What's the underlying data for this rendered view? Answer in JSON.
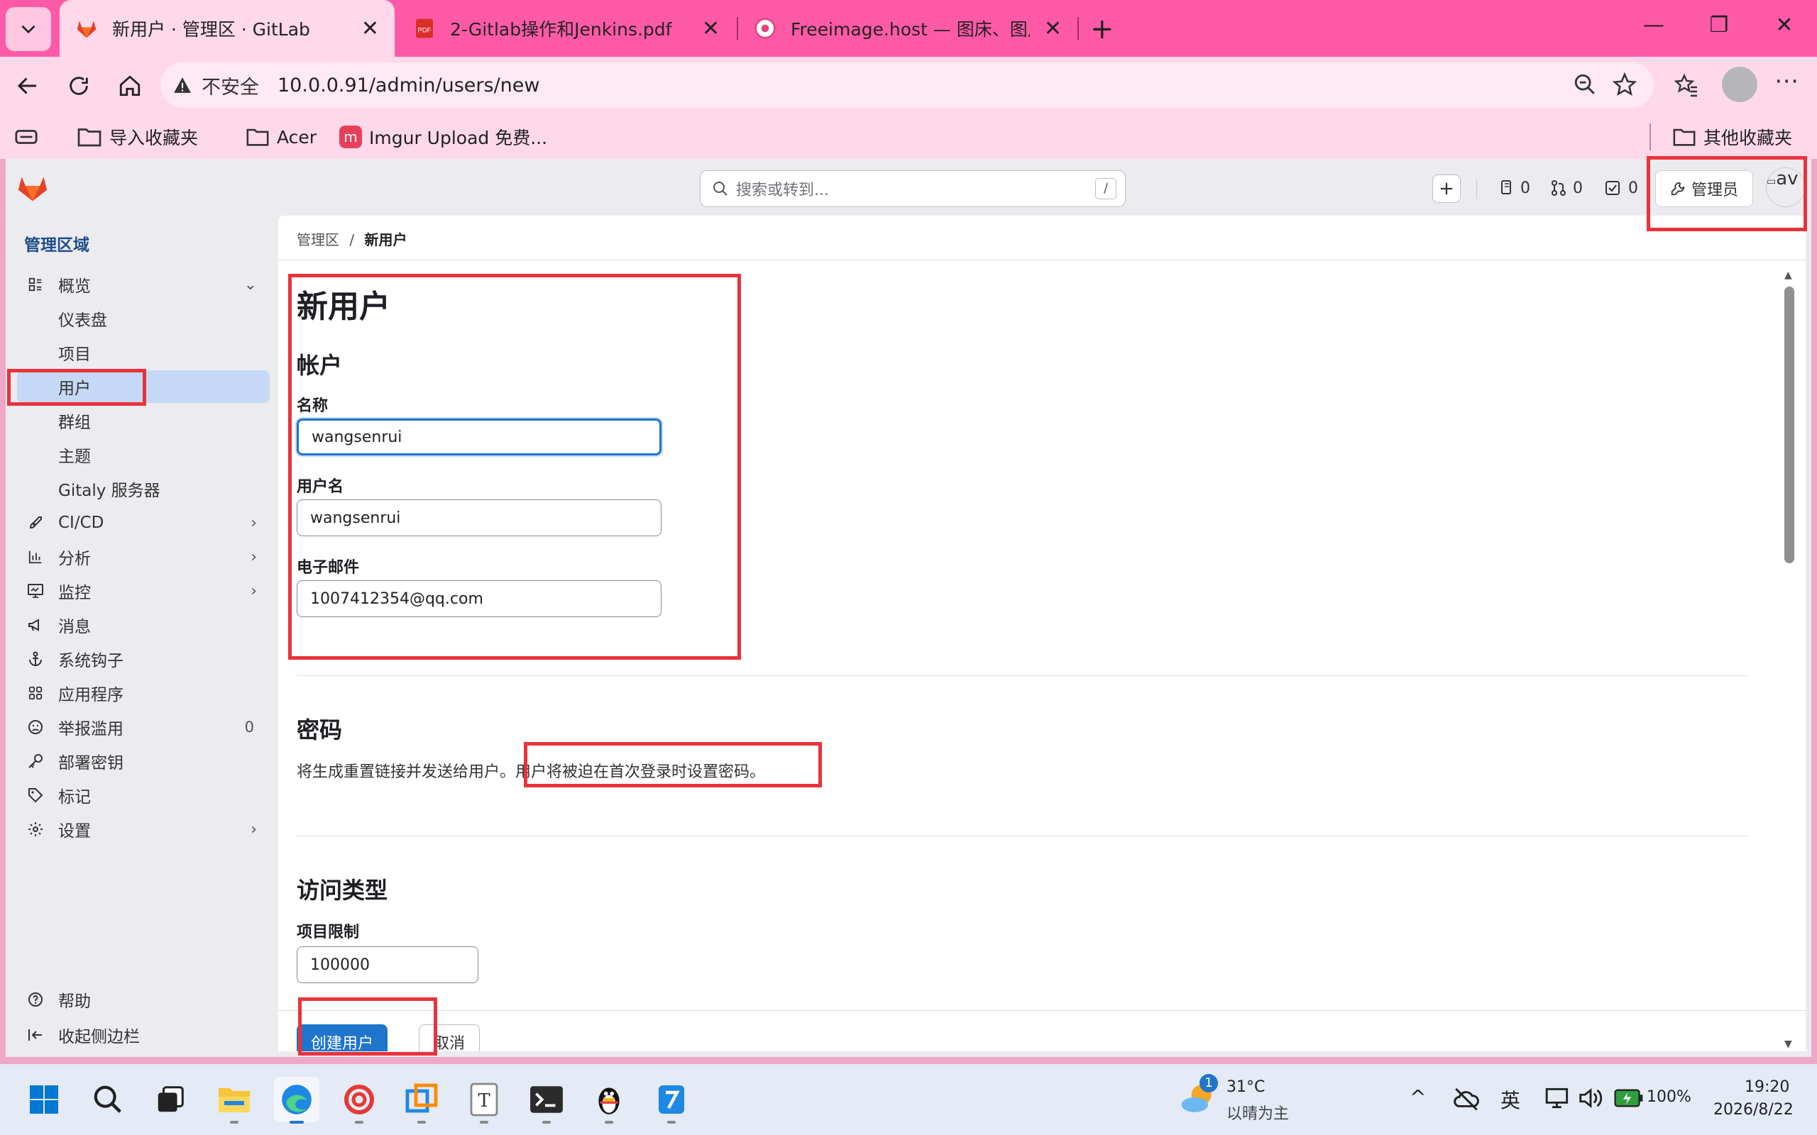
{
  "browser": {
    "tabs": [
      {
        "title": "新用户 · 管理区 · GitLab",
        "active": true
      },
      {
        "title": "2-Gitlab操作和Jenkins.pdf",
        "active": false
      },
      {
        "title": "Freeimage.host — 图床、图片上传",
        "active": false
      }
    ],
    "security_label": "不安全",
    "url": "10.0.0.91/admin/users/new",
    "bookmarks": [
      "导入收藏夹",
      "Acer",
      "Imgur Upload 免费...",
      "其他收藏夹"
    ]
  },
  "gitlab": {
    "search_placeholder": "搜索或转到...",
    "search_shortcut": "/",
    "counters": {
      "issues": "0",
      "merge_requests": "0",
      "todos": "0"
    },
    "admin_button": "管理员",
    "avatar_alt": "av",
    "sidebar": {
      "heading": "管理区域",
      "items": [
        {
          "label": "概览"
        },
        {
          "label": "仪表盘"
        },
        {
          "label": "项目"
        },
        {
          "label": "用户"
        },
        {
          "label": "群组"
        },
        {
          "label": "主题"
        },
        {
          "label": "Gitaly 服务器"
        },
        {
          "label": "CI/CD"
        },
        {
          "label": "分析"
        },
        {
          "label": "监控"
        },
        {
          "label": "消息"
        },
        {
          "label": "系统钩子"
        },
        {
          "label": "应用程序"
        },
        {
          "label": "举报滥用",
          "count": "0"
        },
        {
          "label": "部署密钥"
        },
        {
          "label": "标记"
        },
        {
          "label": "设置"
        }
      ],
      "help": "帮助",
      "collapse": "收起侧边栏"
    },
    "breadcrumb": {
      "parent": "管理区",
      "separator": "/",
      "current": "新用户"
    },
    "page_title": "新用户",
    "account": {
      "heading": "帐户",
      "name_label": "名称",
      "name_value": "wangsenrui",
      "username_label": "用户名",
      "username_value": "wangsenrui",
      "email_label": "电子邮件",
      "email_value": "1007412354@qq.com"
    },
    "password": {
      "heading": "密码",
      "text_1": "将生成重置链接并发送给用户。",
      "text_2": "用户将被迫在首次登录时设置密码。"
    },
    "access": {
      "heading": "访问类型",
      "projects_limit_label": "项目限制",
      "projects_limit_value": "100000"
    },
    "buttons": {
      "create": "创建用户",
      "cancel": "取消"
    }
  },
  "taskbar": {
    "weather": {
      "badge": "1",
      "temp": "31°C",
      "desc": "以晴为主"
    },
    "ime": "英",
    "battery": "100%",
    "time": "19:20",
    "date": "2026/8/22"
  },
  "colors": {
    "tabbar": "#ff5aa8",
    "chrome": "#ffd9ea",
    "primary_button": "#1f75cb",
    "sidebar_active": "#c5d9f6",
    "annotation": "#e8333b"
  }
}
